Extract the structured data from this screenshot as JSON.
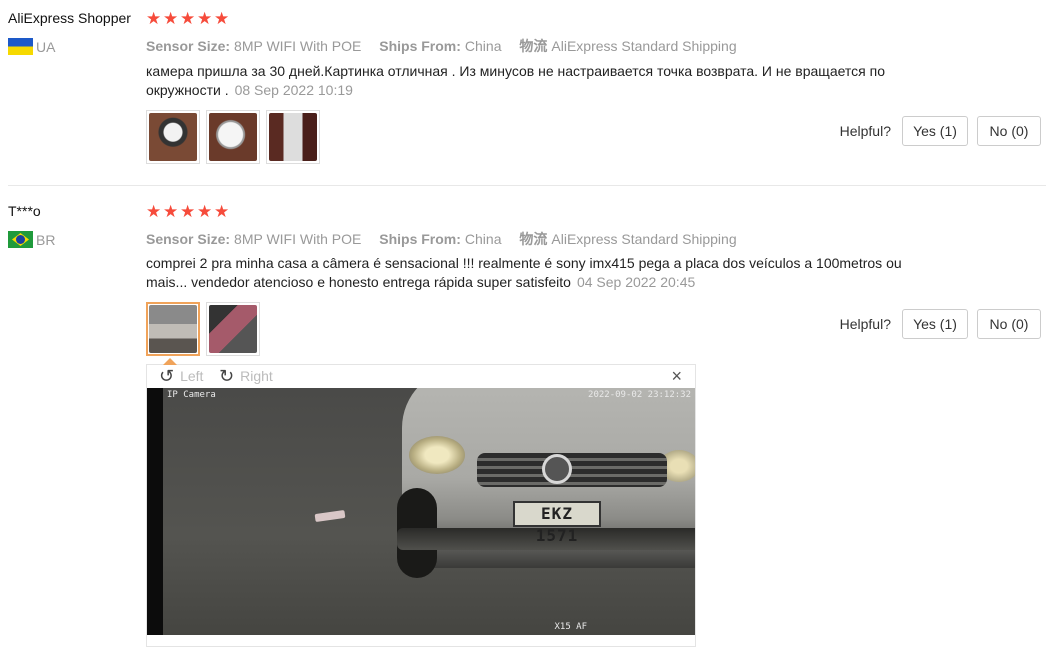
{
  "reviews": [
    {
      "user": "AliExpress Shopper",
      "country": "UA",
      "stars": 5,
      "sensor_label": "Sensor Size:",
      "sensor_value": "8MP WIFI With POE",
      "ships_label": "Ships From:",
      "ships_value": "China",
      "shipping_icon": "物流",
      "shipping_value": "AliExpress Standard Shipping",
      "text": "камера пришла за 30 дней.Картинка отличная . Из минусов не настраивается точка возврата. И не вращается по окружности .",
      "date": "08 Sep 2022 10:19",
      "helpful_label": "Helpful?",
      "yes_label": "Yes (1)",
      "no_label": "No (0)",
      "photo_count": 3
    },
    {
      "user": "T***o",
      "country": "BR",
      "stars": 5,
      "sensor_label": "Sensor Size:",
      "sensor_value": "8MP WIFI With POE",
      "ships_label": "Ships From:",
      "ships_value": "China",
      "shipping_icon": "物流",
      "shipping_value": "AliExpress Standard Shipping",
      "text": "comprei 2 pra minha casa a câmera é sensacional !!! realmente é sony imx415 pega a placa dos veículos a 100metros ou mais... vendedor atencioso e honesto entrega rápida super satisfeito",
      "date": "04 Sep 2022 20:45",
      "helpful_label": "Helpful?",
      "yes_label": "Yes (1)",
      "no_label": "No (0)",
      "photo_count": 2
    }
  ],
  "viewer": {
    "rotate_left": "Left",
    "rotate_right": "Right",
    "close": "×",
    "osd_camera": "IP Camera",
    "osd_timestamp": "2022-09-02 23:12:32",
    "osd_bottom": "X15 AF",
    "plate_text": "EKZ 1571"
  }
}
